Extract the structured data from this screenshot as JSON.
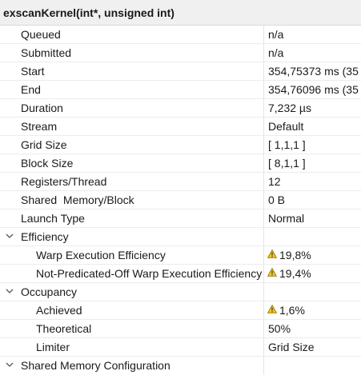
{
  "header": {
    "title": "exscanKernel(int*, unsigned int)"
  },
  "rows": [
    {
      "name": "Queued",
      "value": "n/a"
    },
    {
      "name": "Submitted",
      "value": "n/a"
    },
    {
      "name": "Start",
      "value": "354,75373 ms (35"
    },
    {
      "name": "End",
      "value": "354,76096 ms (35"
    },
    {
      "name": "Duration",
      "value": "7,232 µs"
    },
    {
      "name": "Stream",
      "value": "Default"
    },
    {
      "name": "Grid Size",
      "value": "[ 1,1,1 ]"
    },
    {
      "name": "Block Size",
      "value": "[ 8,1,1 ]"
    },
    {
      "name": "Registers/Thread",
      "value": "12"
    },
    {
      "name": "Shared  Memory/Block",
      "value": "0 B"
    },
    {
      "name": "Launch Type",
      "value": "Normal"
    },
    {
      "name": "Efficiency",
      "value": ""
    },
    {
      "name": "Warp Execution Efficiency",
      "value": "19,8%"
    },
    {
      "name": "Not-Predicated-Off Warp Execution Efficiency",
      "value": "19,4%"
    },
    {
      "name": "Occupancy",
      "value": ""
    },
    {
      "name": "Achieved",
      "value": "1,6%"
    },
    {
      "name": "Theoretical",
      "value": "50%"
    },
    {
      "name": "Limiter",
      "value": "Grid Size"
    },
    {
      "name": "Shared Memory Configuration",
      "value": ""
    }
  ],
  "icons": {
    "expand": "chevron-down-icon",
    "warning": "warning-icon"
  },
  "colors": {
    "warning_fill": "#f5c518",
    "warning_stroke": "#8a6d00"
  }
}
